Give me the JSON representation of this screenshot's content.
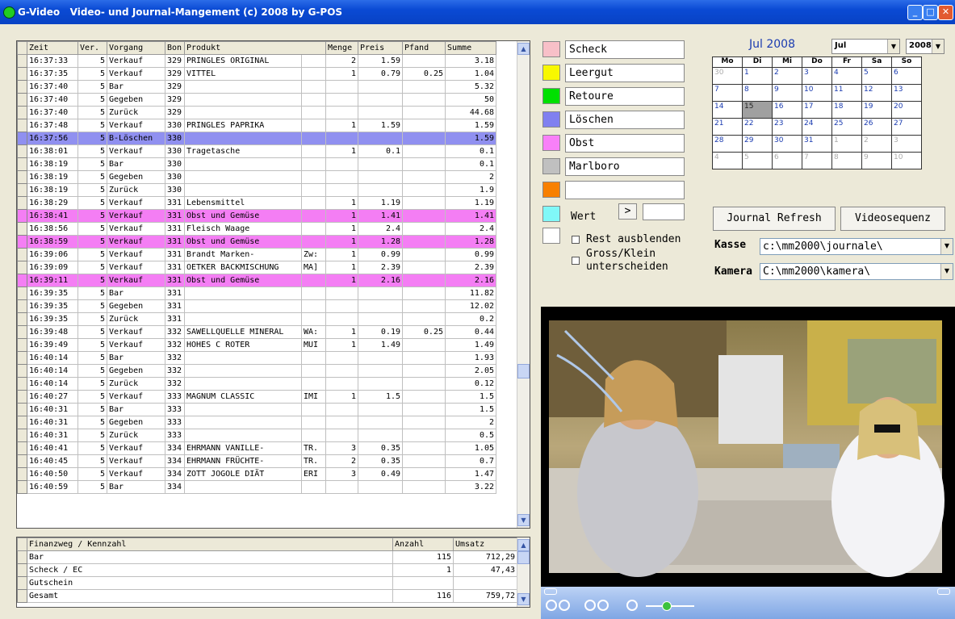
{
  "window": {
    "title": "G-Video   Video- und Journal-Mangement (c) 2008 by G-POS"
  },
  "journal": {
    "headers": [
      "Zeit",
      "Ver.",
      "Vorgang",
      "Bon",
      "Produkt",
      "Menge",
      "Preis",
      "Pfand",
      "Summe"
    ],
    "rows": [
      {
        "zeit": "16:37:33",
        "ver": "5",
        "vorgang": "Verkauf",
        "bon": "329",
        "produkt": "PRINGLES ORIGINAL",
        "extra": "",
        "menge": "2",
        "preis": "1.59",
        "pfand": "",
        "summe": "3.18",
        "hl": ""
      },
      {
        "zeit": "16:37:35",
        "ver": "5",
        "vorgang": "Verkauf",
        "bon": "329",
        "produkt": "VITTEL",
        "extra": "",
        "menge": "1",
        "preis": "0.79",
        "pfand": "0.25",
        "summe": "1.04",
        "hl": ""
      },
      {
        "zeit": "16:37:40",
        "ver": "5",
        "vorgang": "Bar",
        "bon": "329",
        "produkt": "",
        "extra": "",
        "menge": "",
        "preis": "",
        "pfand": "",
        "summe": "5.32",
        "hl": ""
      },
      {
        "zeit": "16:37:40",
        "ver": "5",
        "vorgang": "Gegeben",
        "bon": "329",
        "produkt": "",
        "extra": "",
        "menge": "",
        "preis": "",
        "pfand": "",
        "summe": "50",
        "hl": ""
      },
      {
        "zeit": "16:37:40",
        "ver": "5",
        "vorgang": "Zurück",
        "bon": "329",
        "produkt": "",
        "extra": "",
        "menge": "",
        "preis": "",
        "pfand": "",
        "summe": "44.68",
        "hl": ""
      },
      {
        "zeit": "16:37:48",
        "ver": "5",
        "vorgang": "Verkauf",
        "bon": "330",
        "produkt": "PRINGLES PAPRIKA",
        "extra": "",
        "menge": "1",
        "preis": "1.59",
        "pfand": "",
        "summe": "1.59",
        "hl": ""
      },
      {
        "zeit": "16:37:56",
        "ver": "5",
        "vorgang": "B-Löschen",
        "bon": "330",
        "produkt": "",
        "extra": "",
        "menge": "",
        "preis": "",
        "pfand": "",
        "summe": "1.59",
        "hl": "del"
      },
      {
        "zeit": "16:38:01",
        "ver": "5",
        "vorgang": "Verkauf",
        "bon": "330",
        "produkt": "Tragetasche",
        "extra": "",
        "menge": "1",
        "preis": "0.1",
        "pfand": "",
        "summe": "0.1",
        "hl": ""
      },
      {
        "zeit": "16:38:19",
        "ver": "5",
        "vorgang": "Bar",
        "bon": "330",
        "produkt": "",
        "extra": "",
        "menge": "",
        "preis": "",
        "pfand": "",
        "summe": "0.1",
        "hl": ""
      },
      {
        "zeit": "16:38:19",
        "ver": "5",
        "vorgang": "Gegeben",
        "bon": "330",
        "produkt": "",
        "extra": "",
        "menge": "",
        "preis": "",
        "pfand": "",
        "summe": "2",
        "hl": ""
      },
      {
        "zeit": "16:38:19",
        "ver": "5",
        "vorgang": "Zurück",
        "bon": "330",
        "produkt": "",
        "extra": "",
        "menge": "",
        "preis": "",
        "pfand": "",
        "summe": "1.9",
        "hl": ""
      },
      {
        "zeit": "16:38:29",
        "ver": "5",
        "vorgang": "Verkauf",
        "bon": "331",
        "produkt": "Lebensmittel",
        "extra": "",
        "menge": "1",
        "preis": "1.19",
        "pfand": "",
        "summe": "1.19",
        "hl": ""
      },
      {
        "zeit": "16:38:41",
        "ver": "5",
        "vorgang": "Verkauf",
        "bon": "331",
        "produkt": "Obst und Gemüse",
        "extra": "",
        "menge": "1",
        "preis": "1.41",
        "pfand": "",
        "summe": "1.41",
        "hl": "obst"
      },
      {
        "zeit": "16:38:56",
        "ver": "5",
        "vorgang": "Verkauf",
        "bon": "331",
        "produkt": "Fleisch Waage",
        "extra": "",
        "menge": "1",
        "preis": "2.4",
        "pfand": "",
        "summe": "2.4",
        "hl": ""
      },
      {
        "zeit": "16:38:59",
        "ver": "5",
        "vorgang": "Verkauf",
        "bon": "331",
        "produkt": "Obst und Gemüse",
        "extra": "",
        "menge": "1",
        "preis": "1.28",
        "pfand": "",
        "summe": "1.28",
        "hl": "obst"
      },
      {
        "zeit": "16:39:06",
        "ver": "5",
        "vorgang": "Verkauf",
        "bon": "331",
        "produkt": "Brandt Marken-",
        "extra": "Zw:",
        "menge": "1",
        "preis": "0.99",
        "pfand": "",
        "summe": "0.99",
        "hl": ""
      },
      {
        "zeit": "16:39:09",
        "ver": "5",
        "vorgang": "Verkauf",
        "bon": "331",
        "produkt": "OETKER BACKMISCHUNG",
        "extra": "MA]",
        "menge": "1",
        "preis": "2.39",
        "pfand": "",
        "summe": "2.39",
        "hl": ""
      },
      {
        "zeit": "16:39:11",
        "ver": "5",
        "vorgang": "Verkauf",
        "bon": "331",
        "produkt": "Obst und Gemüse",
        "extra": "",
        "menge": "1",
        "preis": "2.16",
        "pfand": "",
        "summe": "2.16",
        "hl": "obst"
      },
      {
        "zeit": "16:39:35",
        "ver": "5",
        "vorgang": "Bar",
        "bon": "331",
        "produkt": "",
        "extra": "",
        "menge": "",
        "preis": "",
        "pfand": "",
        "summe": "11.82",
        "hl": ""
      },
      {
        "zeit": "16:39:35",
        "ver": "5",
        "vorgang": "Gegeben",
        "bon": "331",
        "produkt": "",
        "extra": "",
        "menge": "",
        "preis": "",
        "pfand": "",
        "summe": "12.02",
        "hl": ""
      },
      {
        "zeit": "16:39:35",
        "ver": "5",
        "vorgang": "Zurück",
        "bon": "331",
        "produkt": "",
        "extra": "",
        "menge": "",
        "preis": "",
        "pfand": "",
        "summe": "0.2",
        "hl": ""
      },
      {
        "zeit": "16:39:48",
        "ver": "5",
        "vorgang": "Verkauf",
        "bon": "332",
        "produkt": "SAWELLQUELLE MINERAL",
        "extra": "WA:",
        "menge": "1",
        "preis": "0.19",
        "pfand": "0.25",
        "summe": "0.44",
        "hl": ""
      },
      {
        "zeit": "16:39:49",
        "ver": "5",
        "vorgang": "Verkauf",
        "bon": "332",
        "produkt": "HOHES C ROTER",
        "extra": "MUI",
        "menge": "1",
        "preis": "1.49",
        "pfand": "",
        "summe": "1.49",
        "hl": ""
      },
      {
        "zeit": "16:40:14",
        "ver": "5",
        "vorgang": "Bar",
        "bon": "332",
        "produkt": "",
        "extra": "",
        "menge": "",
        "preis": "",
        "pfand": "",
        "summe": "1.93",
        "hl": ""
      },
      {
        "zeit": "16:40:14",
        "ver": "5",
        "vorgang": "Gegeben",
        "bon": "332",
        "produkt": "",
        "extra": "",
        "menge": "",
        "preis": "",
        "pfand": "",
        "summe": "2.05",
        "hl": ""
      },
      {
        "zeit": "16:40:14",
        "ver": "5",
        "vorgang": "Zurück",
        "bon": "332",
        "produkt": "",
        "extra": "",
        "menge": "",
        "preis": "",
        "pfand": "",
        "summe": "0.12",
        "hl": ""
      },
      {
        "zeit": "16:40:27",
        "ver": "5",
        "vorgang": "Verkauf",
        "bon": "333",
        "produkt": "MAGNUM CLASSIC",
        "extra": "IMI",
        "menge": "1",
        "preis": "1.5",
        "pfand": "",
        "summe": "1.5",
        "hl": ""
      },
      {
        "zeit": "16:40:31",
        "ver": "5",
        "vorgang": "Bar",
        "bon": "333",
        "produkt": "",
        "extra": "",
        "menge": "",
        "preis": "",
        "pfand": "",
        "summe": "1.5",
        "hl": ""
      },
      {
        "zeit": "16:40:31",
        "ver": "5",
        "vorgang": "Gegeben",
        "bon": "333",
        "produkt": "",
        "extra": "",
        "menge": "",
        "preis": "",
        "pfand": "",
        "summe": "2",
        "hl": ""
      },
      {
        "zeit": "16:40:31",
        "ver": "5",
        "vorgang": "Zurück",
        "bon": "333",
        "produkt": "",
        "extra": "",
        "menge": "",
        "preis": "",
        "pfand": "",
        "summe": "0.5",
        "hl": ""
      },
      {
        "zeit": "16:40:41",
        "ver": "5",
        "vorgang": "Verkauf",
        "bon": "334",
        "produkt": "EHRMANN VANILLE-",
        "extra": "TR.",
        "menge": "3",
        "preis": "0.35",
        "pfand": "",
        "summe": "1.05",
        "hl": ""
      },
      {
        "zeit": "16:40:45",
        "ver": "5",
        "vorgang": "Verkauf",
        "bon": "334",
        "produkt": "EHRMANN FRÜCHTE-",
        "extra": "TR.",
        "menge": "2",
        "preis": "0.35",
        "pfand": "",
        "summe": "0.7",
        "hl": ""
      },
      {
        "zeit": "16:40:50",
        "ver": "5",
        "vorgang": "Verkauf",
        "bon": "334",
        "produkt": "ZOTT JOGOLE DIÄT",
        "extra": "ERI",
        "menge": "3",
        "preis": "0.49",
        "pfand": "",
        "summe": "1.47",
        "hl": ""
      },
      {
        "zeit": "16:40:59",
        "ver": "5",
        "vorgang": "Bar",
        "bon": "334",
        "produkt": "",
        "extra": "",
        "menge": "",
        "preis": "",
        "pfand": "",
        "summe": "3.22",
        "hl": ""
      }
    ]
  },
  "summary": {
    "headers": [
      "Finanzweg / Kennzahl",
      "Anzahl",
      "Umsatz"
    ],
    "rows": [
      {
        "name": "Bar",
        "anzahl": "115",
        "umsatz": "712,29"
      },
      {
        "name": "Scheck / EC",
        "anzahl": "1",
        "umsatz": "47,43"
      },
      {
        "name": "Gutschein",
        "anzahl": "",
        "umsatz": ""
      },
      {
        "name": "Gesamt",
        "anzahl": "116",
        "umsatz": "759,72"
      }
    ]
  },
  "filters": [
    {
      "color": "#f8c0c8",
      "label": "Scheck"
    },
    {
      "color": "#f8f800",
      "label": "Leergut"
    },
    {
      "color": "#00e000",
      "label": "Retoure"
    },
    {
      "color": "#8080f0",
      "label": "Löschen"
    },
    {
      "color": "#f880f8",
      "label": "Obst"
    },
    {
      "color": "#c0c0c0",
      "label": "Marlboro"
    },
    {
      "color": "#f88000",
      "label": ""
    }
  ],
  "wert": {
    "color": "#80f8f8",
    "label": "Wert",
    "button": ">",
    "value": ""
  },
  "blank_swatch_color": "#ffffff",
  "options": {
    "rest": "Rest ausblenden",
    "gross": "Gross/Klein",
    "gross2": "unterscheiden"
  },
  "calendar": {
    "title": "Jul 2008",
    "month_select": "Jul",
    "year_select": "2008",
    "weekdays": [
      "Mo",
      "Di",
      "Mi",
      "Do",
      "Fr",
      "Sa",
      "So"
    ],
    "weeks": [
      [
        {
          "d": "30",
          "o": true
        },
        {
          "d": "1"
        },
        {
          "d": "2"
        },
        {
          "d": "3"
        },
        {
          "d": "4"
        },
        {
          "d": "5"
        },
        {
          "d": "6"
        }
      ],
      [
        {
          "d": "7"
        },
        {
          "d": "8"
        },
        {
          "d": "9"
        },
        {
          "d": "10"
        },
        {
          "d": "11"
        },
        {
          "d": "12"
        },
        {
          "d": "13"
        }
      ],
      [
        {
          "d": "14"
        },
        {
          "d": "15",
          "sel": true
        },
        {
          "d": "16"
        },
        {
          "d": "17"
        },
        {
          "d": "18"
        },
        {
          "d": "19"
        },
        {
          "d": "20"
        }
      ],
      [
        {
          "d": "21"
        },
        {
          "d": "22"
        },
        {
          "d": "23"
        },
        {
          "d": "24"
        },
        {
          "d": "25"
        },
        {
          "d": "26"
        },
        {
          "d": "27"
        }
      ],
      [
        {
          "d": "28"
        },
        {
          "d": "29"
        },
        {
          "d": "30"
        },
        {
          "d": "31"
        },
        {
          "d": "1",
          "o": true
        },
        {
          "d": "2",
          "o": true
        },
        {
          "d": "3",
          "o": true
        }
      ],
      [
        {
          "d": "4",
          "o": true
        },
        {
          "d": "5",
          "o": true
        },
        {
          "d": "6",
          "o": true
        },
        {
          "d": "7",
          "o": true
        },
        {
          "d": "8",
          "o": true
        },
        {
          "d": "9",
          "o": true
        },
        {
          "d": "10",
          "o": true
        }
      ]
    ]
  },
  "buttons": {
    "refresh": "Journal Refresh",
    "video": "Videosequenz"
  },
  "paths": {
    "kasse_label": "Kasse",
    "kasse": "c:\\mm2000\\journale\\",
    "kamera_label": "Kamera",
    "kamera": "C:\\mm2000\\kamera\\"
  }
}
